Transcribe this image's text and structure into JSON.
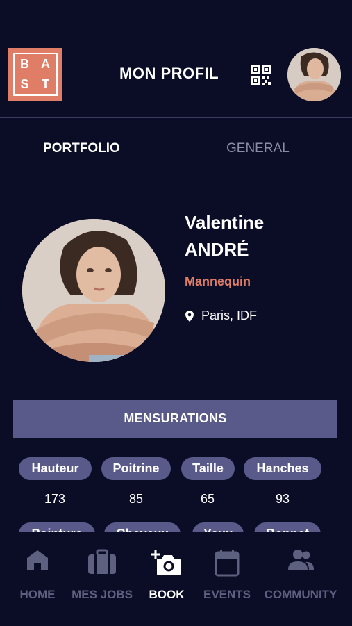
{
  "header": {
    "logo_letters": [
      "B",
      "A",
      "S",
      "T"
    ],
    "title": "MON PROFIL"
  },
  "tabs": [
    {
      "label": "PORTFOLIO",
      "active": true
    },
    {
      "label": "GENERAL",
      "active": false
    }
  ],
  "profile": {
    "first_name": "Valentine",
    "last_name": "ANDRÉ",
    "role": "Mannequin",
    "location": "Paris, IDF"
  },
  "measurements": {
    "section_label": "MENSURATIONS",
    "items": [
      {
        "label": "Hauteur",
        "value": "173"
      },
      {
        "label": "Poitrine",
        "value": "85"
      },
      {
        "label": "Taille",
        "value": "65"
      },
      {
        "label": "Hanches",
        "value": "93"
      }
    ],
    "partial_row": [
      "Pointure",
      "Cheveux",
      "Yeux",
      "Bonnet"
    ]
  },
  "nav": [
    {
      "label": "HOME",
      "icon": "home-icon",
      "active": false
    },
    {
      "label": "MES JOBS",
      "icon": "briefcase-icon",
      "active": false
    },
    {
      "label": "BOOK",
      "icon": "camera-add-icon",
      "active": true
    },
    {
      "label": "EVENTS",
      "icon": "calendar-icon",
      "active": false
    },
    {
      "label": "COMMUNITY",
      "icon": "people-icon",
      "active": false
    }
  ],
  "colors": {
    "background": "#0b0c26",
    "accent": "#e07d67",
    "pill": "#595a8a",
    "nav_inactive": "#5e607f"
  }
}
